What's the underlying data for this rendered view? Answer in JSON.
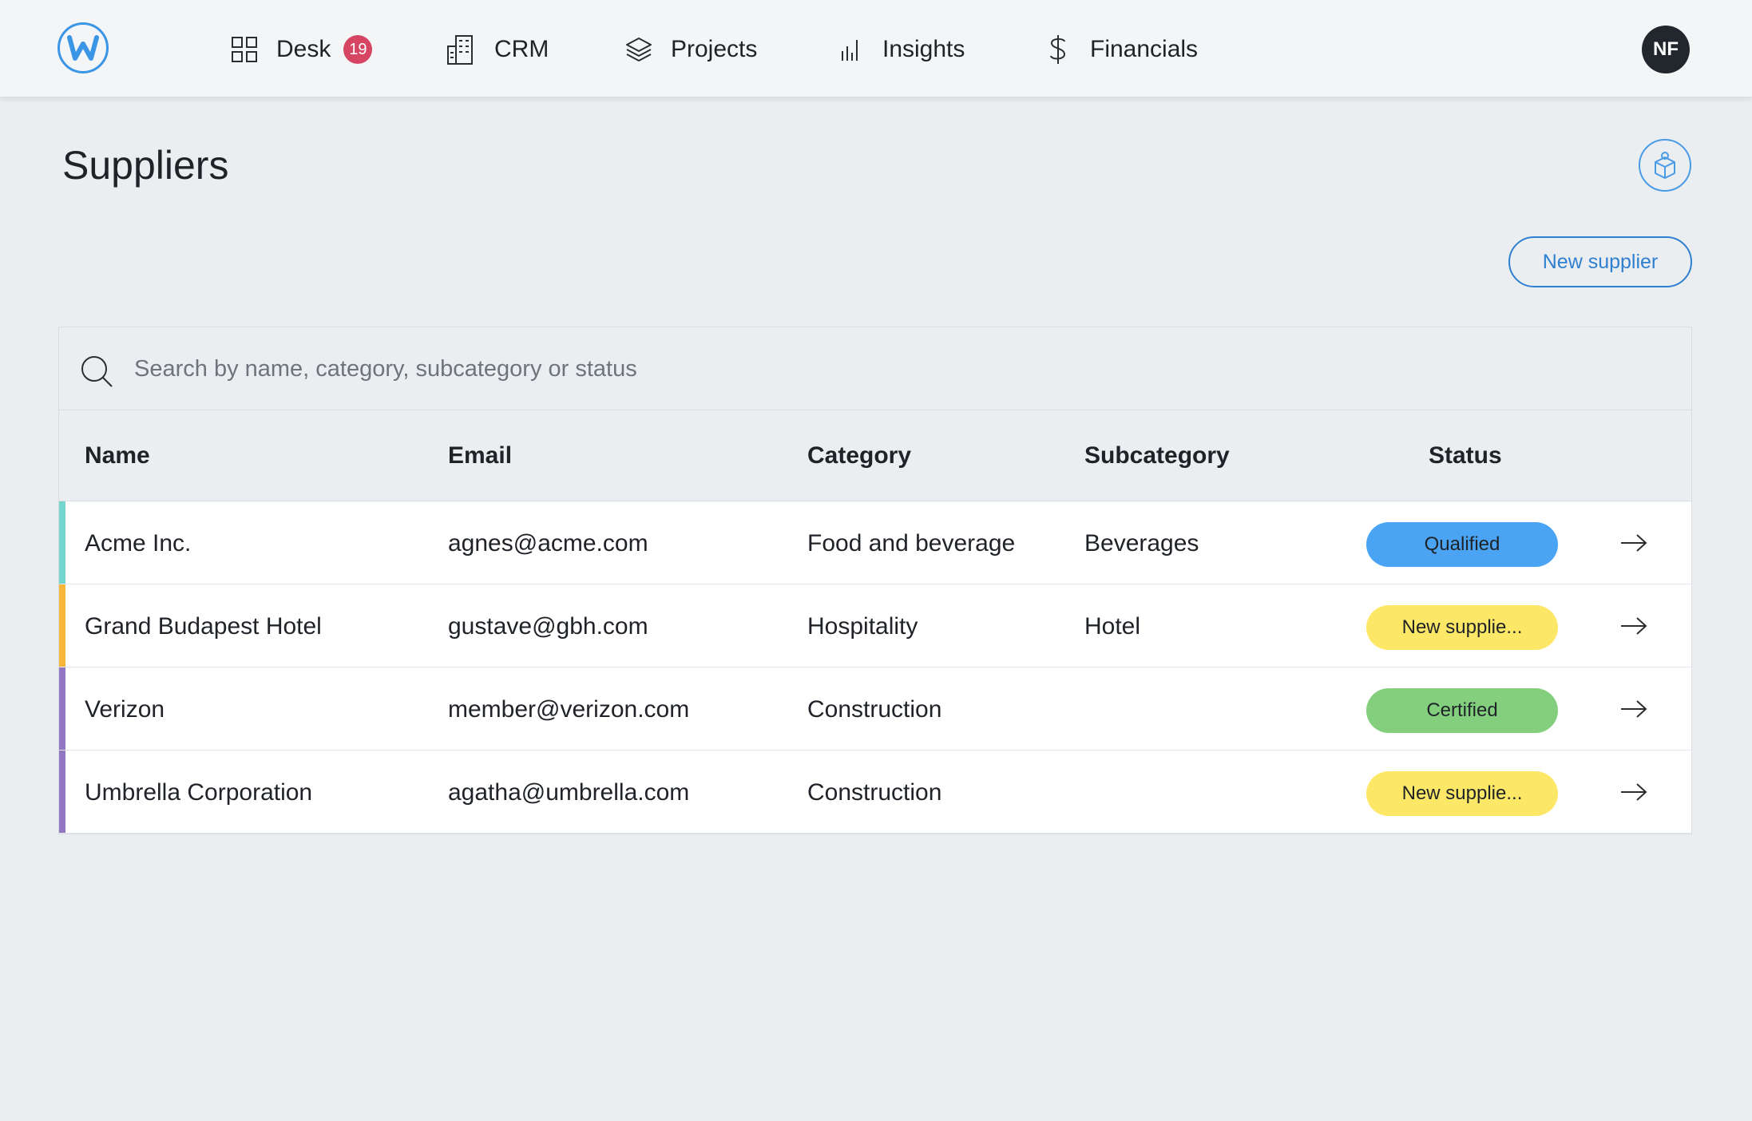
{
  "colors": {
    "brand": "#3b95e6",
    "badge": "#d64562",
    "qualified": "#4aa3f3",
    "new_supplier": "#fde767",
    "certified": "#83cf7e",
    "accent_teal": "#72d6cc",
    "accent_orange": "#f6b63c",
    "accent_purple": "#9176c2"
  },
  "nav": {
    "logo_letter": "W",
    "items": [
      {
        "label": "Desk",
        "icon": "grid-icon",
        "badge": "19"
      },
      {
        "label": "CRM",
        "icon": "building-icon"
      },
      {
        "label": "Projects",
        "icon": "layers-icon"
      },
      {
        "label": "Insights",
        "icon": "bar-chart-icon"
      },
      {
        "label": "Financials",
        "icon": "dollar-icon"
      }
    ],
    "avatar_initials": "NF"
  },
  "page": {
    "title": "Suppliers",
    "new_supplier_label": "New supplier"
  },
  "search": {
    "placeholder": "Search by name, category, subcategory or status",
    "value": ""
  },
  "table": {
    "columns": [
      "Name",
      "Email",
      "Category",
      "Subcategory",
      "Status"
    ],
    "rows": [
      {
        "name": "Acme Inc.",
        "email": "agnes@acme.com",
        "category": "Food and beverage",
        "subcategory": "Beverages",
        "status": "Qualified",
        "status_color": "#4aa3f3",
        "accent": "#72d6cc"
      },
      {
        "name": "Grand Budapest Hotel",
        "email": "gustave@gbh.com",
        "category": "Hospitality",
        "subcategory": "Hotel",
        "status": "New supplie...",
        "status_color": "#fde767",
        "accent": "#f6b63c"
      },
      {
        "name": "Verizon",
        "email": "member@verizon.com",
        "category": "Construction",
        "subcategory": "",
        "status": "Certified",
        "status_color": "#83cf7e",
        "accent": "#9176c2"
      },
      {
        "name": "Umbrella Corporation",
        "email": "agatha@umbrella.com",
        "category": "Construction",
        "subcategory": "",
        "status": "New supplie...",
        "status_color": "#fde767",
        "accent": "#9176c2"
      }
    ]
  }
}
